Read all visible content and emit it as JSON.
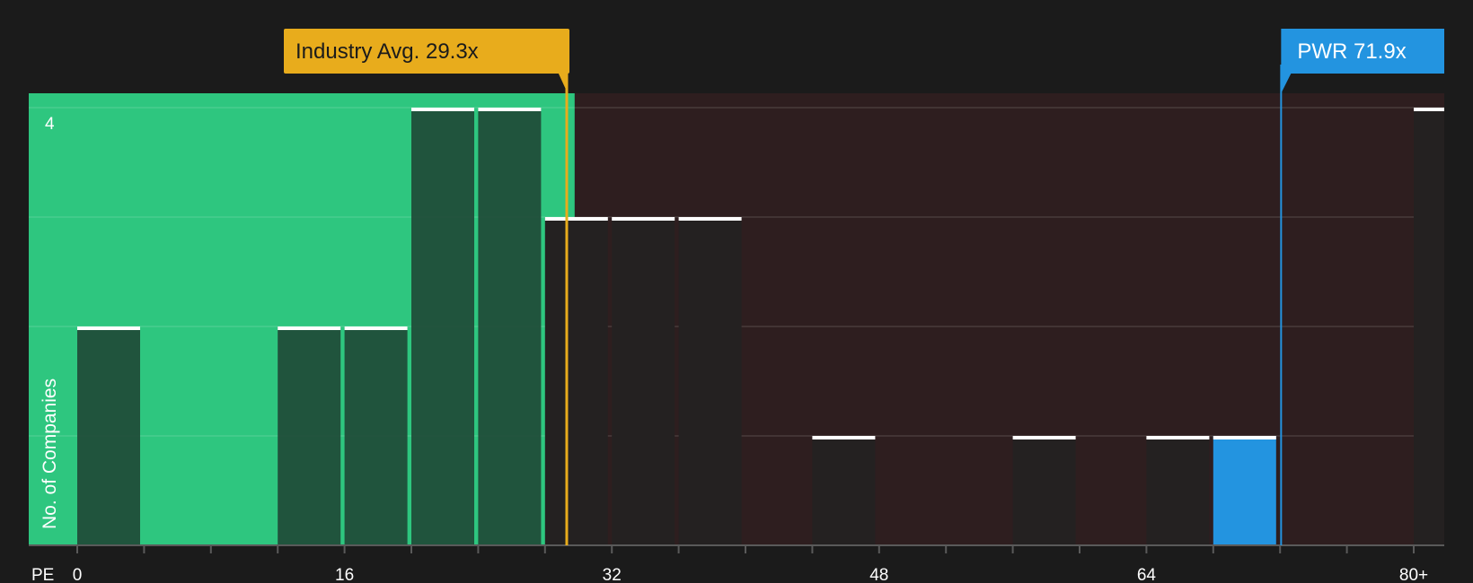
{
  "chart_data": {
    "type": "bar",
    "xlabel": "PE",
    "ylabel": "No. of Companies",
    "x_ticks": [
      "0",
      "16",
      "32",
      "48",
      "64",
      "80+"
    ],
    "y_tick_label": "4",
    "ylim": [
      0,
      4
    ],
    "bin_width": 4,
    "bins": [
      {
        "start": 0,
        "count": 2
      },
      {
        "start": 12,
        "count": 2
      },
      {
        "start": 16,
        "count": 2
      },
      {
        "start": 20,
        "count": 4
      },
      {
        "start": 24,
        "count": 4
      },
      {
        "start": 28,
        "count": 3
      },
      {
        "start": 32,
        "count": 3
      },
      {
        "start": 36,
        "count": 3
      },
      {
        "start": 44,
        "count": 1
      },
      {
        "start": 56,
        "count": 1
      },
      {
        "start": 64,
        "count": 1
      },
      {
        "start": 68,
        "count": 1,
        "highlight": true
      },
      {
        "start": 80,
        "count": 4
      }
    ],
    "green_zone_end": 28,
    "industry_avg": {
      "label": "Industry Avg. 29.3x",
      "value": 29.3
    },
    "company": {
      "label": "PWR 71.9x",
      "value": 71.9
    },
    "colors": {
      "background": "#1b1b1b",
      "undervalued_zone": "#2ec67f",
      "overvalued_zone": "#2e1e1f",
      "bar_in_green": "#1f4a37",
      "bar_default": "#242121",
      "bar_highlight": "#2394e0",
      "industry_marker": "#e8ac1c",
      "company_marker": "#2394e0",
      "bar_cap": "#ffffff"
    }
  }
}
